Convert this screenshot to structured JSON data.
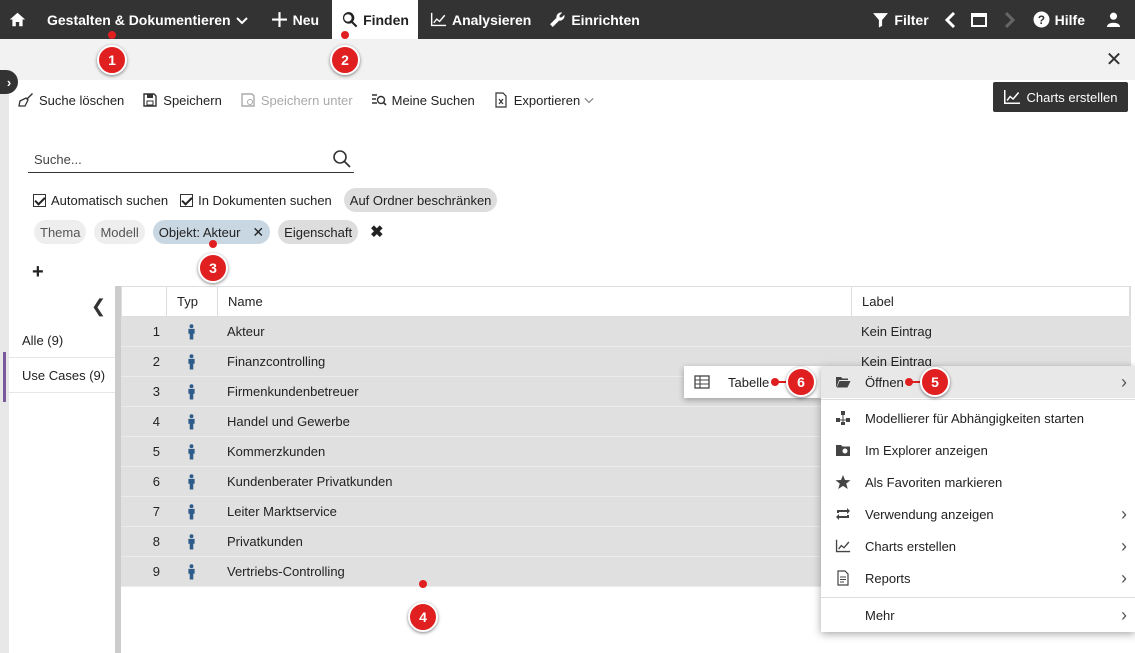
{
  "topnav": {
    "design_label": "Gestalten & Dokumentieren",
    "new_label": "Neu",
    "find_label": "Finden",
    "analyze_label": "Analysieren",
    "setup_label": "Einrichten",
    "filter_label": "Filter",
    "help_label": "Hilfe"
  },
  "toolbar": {
    "clear_search": "Suche löschen",
    "save": "Speichern",
    "save_as": "Speichern unter",
    "my_searches": "Meine Suchen",
    "export": "Exportieren",
    "charts": "Charts erstellen"
  },
  "search": {
    "placeholder": "Suche..."
  },
  "options": {
    "auto_search": "Automatisch suchen",
    "in_documents": "In Dokumenten suchen",
    "restrict_folder": "Auf Ordner beschränken"
  },
  "filters": {
    "topic": "Thema",
    "model": "Modell",
    "object": "Objekt: Akteur",
    "property": "Eigenschaft"
  },
  "sidebar": {
    "items": [
      {
        "label": "Alle (9)"
      },
      {
        "label": "Use Cases (9)"
      }
    ]
  },
  "table": {
    "columns": {
      "type": "Typ",
      "name": "Name",
      "label": "Label"
    },
    "rows": [
      {
        "num": "1",
        "name": "Akteur",
        "label": "Kein Eintrag"
      },
      {
        "num": "2",
        "name": "Finanzcontrolling",
        "label": "Kein Eintrag"
      },
      {
        "num": "3",
        "name": "Firmenkundenbetreuer",
        "label": ""
      },
      {
        "num": "4",
        "name": "Handel und Gewerbe",
        "label": ""
      },
      {
        "num": "5",
        "name": "Kommerzkunden",
        "label": ""
      },
      {
        "num": "6",
        "name": "Kundenberater Privatkunden",
        "label": ""
      },
      {
        "num": "7",
        "name": "Leiter Marktservice",
        "label": ""
      },
      {
        "num": "8",
        "name": "Privatkunden",
        "label": ""
      },
      {
        "num": "9",
        "name": "Vertriebs-Controlling",
        "label": ""
      }
    ]
  },
  "context_menu": {
    "open": "Öffnen",
    "modeler": "Modellierer für Abhängigkeiten starten",
    "explorer": "Im Explorer anzeigen",
    "favorites": "Als Favoriten markieren",
    "usage": "Verwendung anzeigen",
    "charts": "Charts erstellen",
    "reports": "Reports",
    "more": "Mehr"
  },
  "submenu": {
    "table": "Tabelle"
  },
  "annotations": [
    "1",
    "2",
    "3",
    "4",
    "5",
    "6"
  ],
  "colors": {
    "topbar": "#333333",
    "badge": "#e02020",
    "row": "#e0e0e0",
    "selected_pill": "#c9d7e3"
  }
}
